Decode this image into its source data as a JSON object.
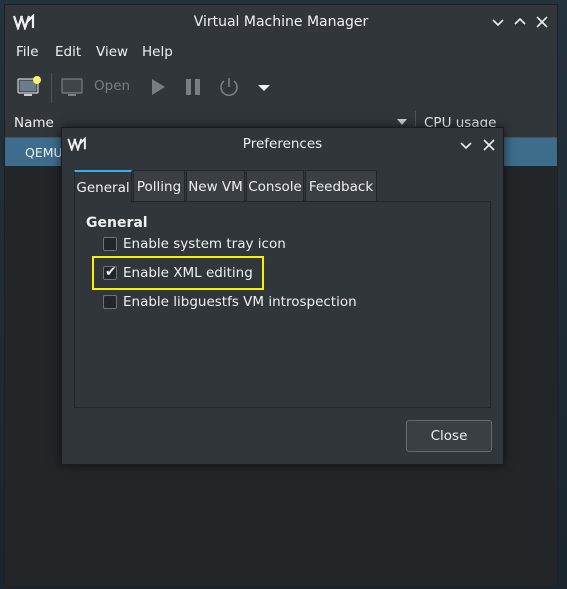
{
  "window": {
    "title": "Virtual Machine Manager",
    "controls": [
      "chevron-down-icon",
      "chevron-up-icon",
      "close-icon"
    ]
  },
  "menubar": {
    "items": [
      {
        "label": "File"
      },
      {
        "label": "Edit"
      },
      {
        "label": "View"
      },
      {
        "label": "Help"
      }
    ]
  },
  "toolbar": {
    "open_label": "Open"
  },
  "vm_list": {
    "columns": {
      "name": "Name",
      "cpu": "CPU usage"
    },
    "rows": [
      {
        "name": "QEMU/"
      }
    ]
  },
  "dialog": {
    "title": "Preferences",
    "tabs": [
      {
        "label": "General",
        "active": true
      },
      {
        "label": "Polling"
      },
      {
        "label": "New VM"
      },
      {
        "label": "Console"
      },
      {
        "label": "Feedback"
      }
    ],
    "section_title": "General",
    "options": [
      {
        "label": "Enable system tray icon",
        "checked": false
      },
      {
        "label": "Enable XML editing",
        "checked": true
      },
      {
        "label": "Enable libguestfs VM introspection",
        "checked": false
      }
    ],
    "close_label": "Close"
  },
  "colors": {
    "accent": "#3daee9",
    "selection": "#3d6c8c",
    "highlight": "#f6f200"
  }
}
